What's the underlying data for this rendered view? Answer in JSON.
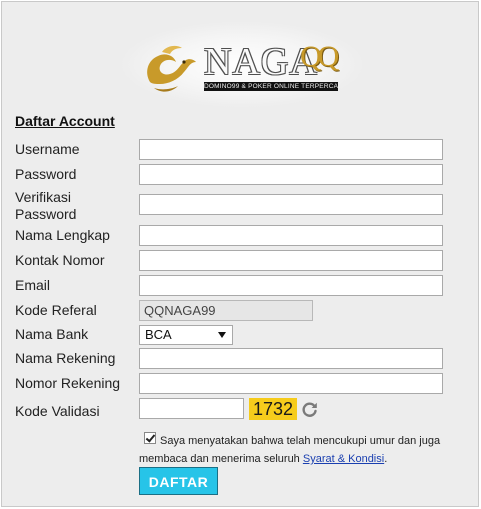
{
  "brand": {
    "name": "NAGA",
    "suffix": "QQ",
    "tagline": "DOMINO99 & POKER ONLINE TERPERCAYA"
  },
  "form": {
    "title": "Daftar Account",
    "fields": {
      "username": {
        "label": "Username",
        "value": ""
      },
      "password": {
        "label": "Password",
        "value": ""
      },
      "verify_password": {
        "label_line1": "Verifikasi",
        "label_line2": "Password",
        "value": ""
      },
      "full_name": {
        "label": "Nama Lengkap",
        "value": ""
      },
      "contact": {
        "label": "Kontak Nomor",
        "value": ""
      },
      "email": {
        "label": "Email",
        "value": ""
      },
      "referral": {
        "label": "Kode Referal",
        "value": "QQNAGA99"
      },
      "bank": {
        "label": "Nama Bank",
        "selected": "BCA"
      },
      "account_name": {
        "label": "Nama Rekening",
        "value": ""
      },
      "account_number": {
        "label": "Nomor Rekening",
        "value": ""
      },
      "validation": {
        "label": "Kode Validasi",
        "value": "",
        "captcha": "1732"
      }
    },
    "agreement": {
      "checked": true,
      "line1": "Saya menyatakan bahwa telah mencukupi umur dan juga",
      "line2_prefix": "membaca dan menerima seluruh",
      "link": "Syarat & Kondisi",
      "line2_suffix": "."
    },
    "submit_label": "DAFTAR"
  },
  "colors": {
    "panel": "#ededed",
    "captcha_bg": "#f6cc1c",
    "button_bg": "#27c4e8",
    "link": "#1a3fb0",
    "logo_gold": "#c89a2a"
  },
  "icons": [
    "dragon-logo-icon",
    "refresh-icon",
    "checkbox-check-icon",
    "dropdown-caret-icon"
  ]
}
